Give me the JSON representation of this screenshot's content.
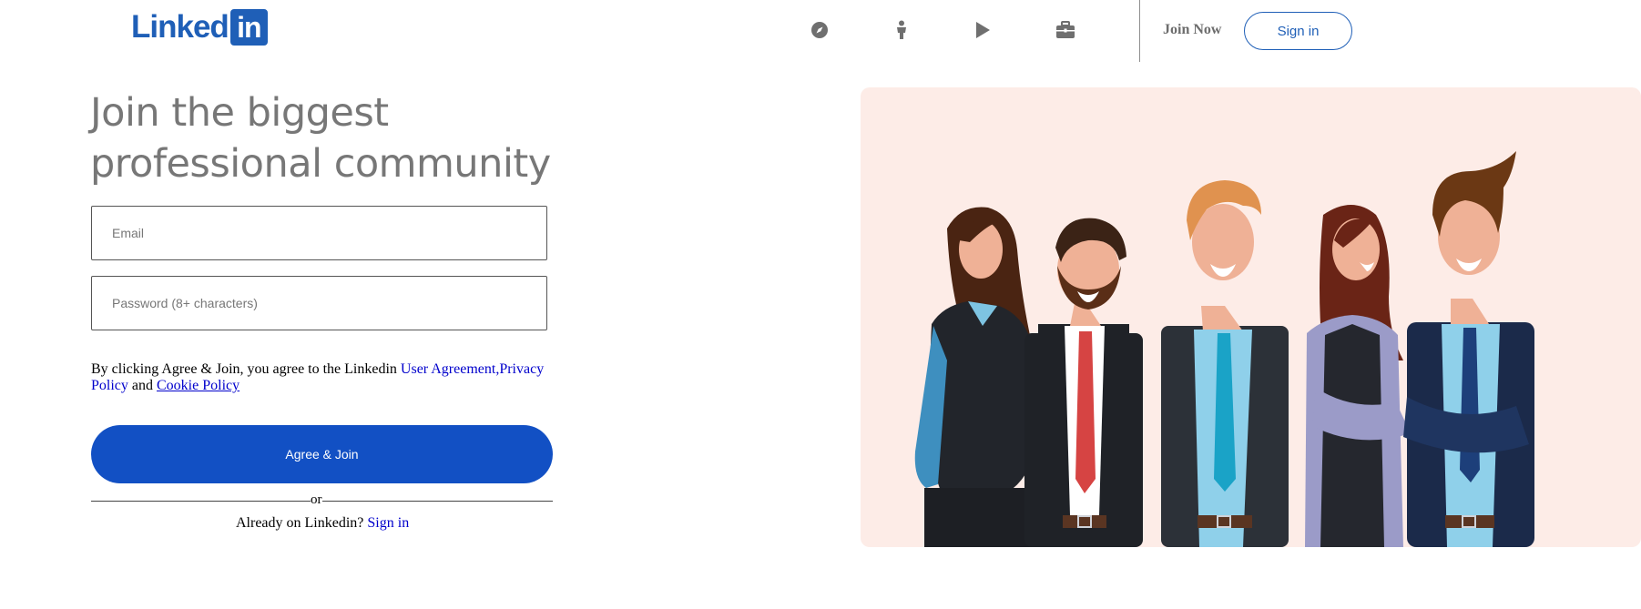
{
  "header": {
    "logo_text": "Linked",
    "logo_box_text": "in",
    "nav_icons": [
      "compass-icon",
      "person-icon",
      "play-icon",
      "briefcase-icon"
    ],
    "join_now_label": "Join Now",
    "sign_in_label": "Sign in"
  },
  "main": {
    "headline": "Join the biggest professional community",
    "email_placeholder": "Email",
    "password_placeholder": "Password (8+ characters)",
    "terms": {
      "prefix": "By clicking Agree & Join, you agree to the Linkedin ",
      "user_agreement": "User Agreement,",
      "privacy_policy": "Privacy Policy",
      "and": " and ",
      "cookie_policy": "Cookie Policy"
    },
    "agree_button": "Agree & Join",
    "or_text": "or",
    "already_text": "Already on Linkedin? ",
    "sign_in_link": "Sign in"
  },
  "colors": {
    "brand": "#1f5fb7",
    "primary_button": "#1250c4",
    "illustration_bg": "#fdece7"
  }
}
